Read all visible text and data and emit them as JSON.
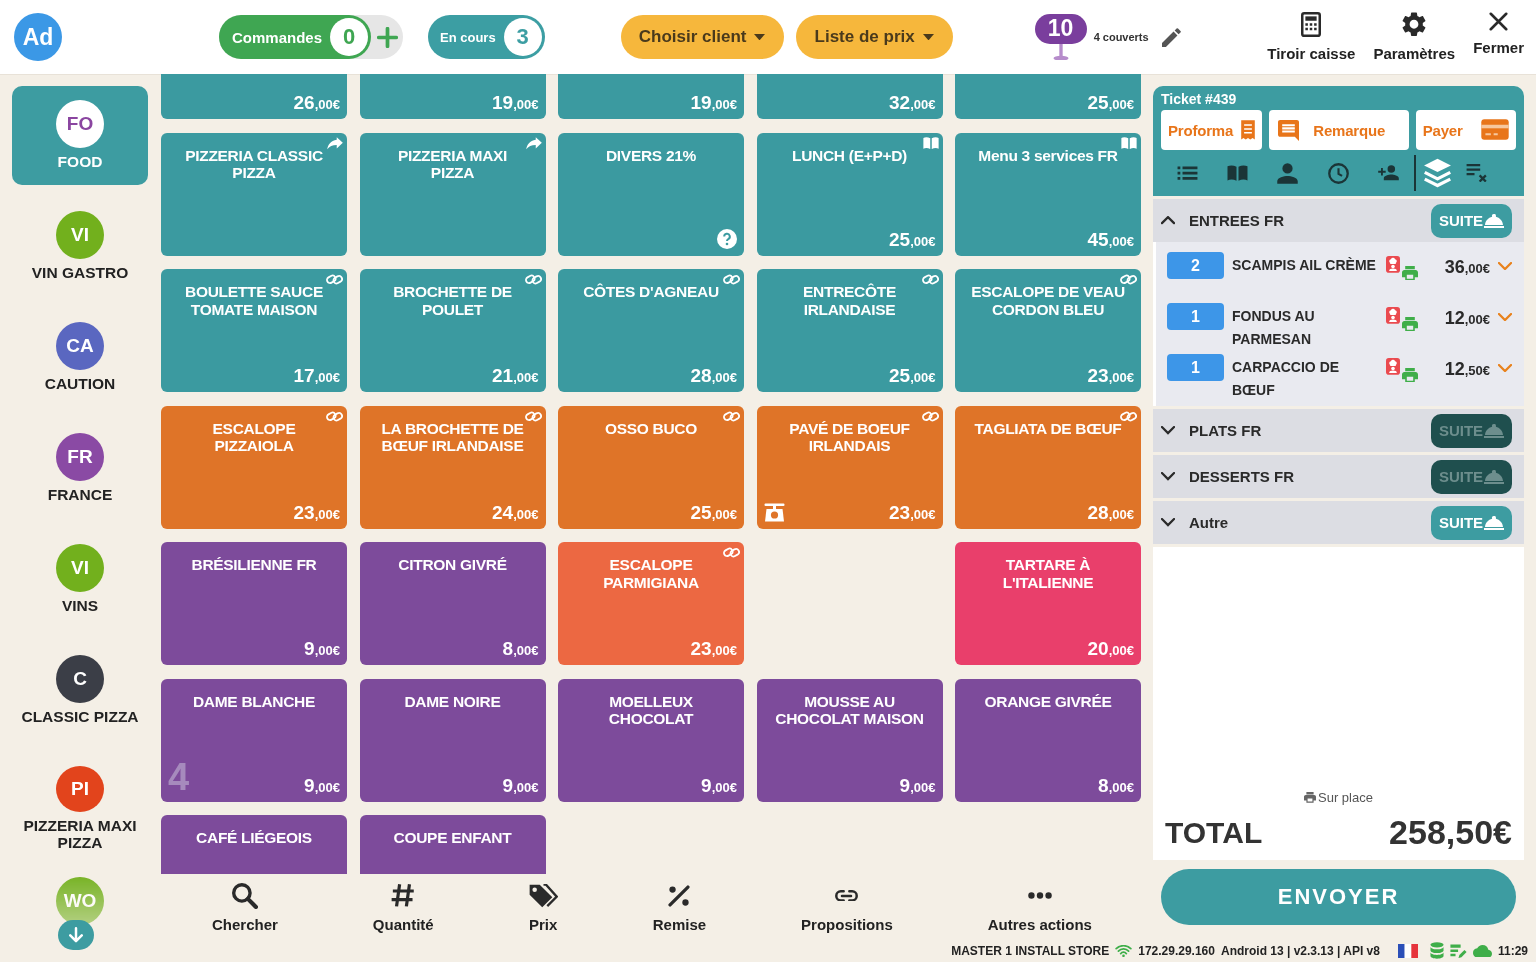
{
  "topbar": {
    "avatar": "Ad",
    "orders": {
      "label": "Commandes",
      "count": "0"
    },
    "in_progress": {
      "label": "En cours",
      "count": "3"
    },
    "client_button": "Choisir client",
    "price_list_button": "Liste de prix",
    "table": {
      "number": "10",
      "covers": "4 couverts"
    },
    "actions": [
      {
        "kind": "calculator",
        "label": "Tiroir caisse"
      },
      {
        "kind": "gear",
        "label": "Paramètres"
      },
      {
        "kind": "close",
        "label": "Fermer"
      }
    ]
  },
  "categories": [
    {
      "initials": "FO",
      "label": "FOOD",
      "color": "#8a45a0",
      "selected": true
    },
    {
      "initials": "VI",
      "label": "VIN GASTRO",
      "color": "#72b01d",
      "selected": false
    },
    {
      "initials": "CA",
      "label": "CAUTION",
      "color": "#5a67c0",
      "selected": false
    },
    {
      "initials": "FR",
      "label": "FRANCE",
      "color": "#8a4aa4",
      "selected": false
    },
    {
      "initials": "VI",
      "label": "VINS",
      "color": "#72b01d",
      "selected": false
    },
    {
      "initials": "C",
      "label": "CLASSIC PIZZA",
      "color": "#3b3e47",
      "selected": false
    },
    {
      "initials": "PI",
      "label": "PIZZERIA MAXI PIZZA",
      "color": "#e2441c",
      "selected": false
    },
    {
      "initials": "WO",
      "color": "#72b01d",
      "selected": false
    }
  ],
  "tiles": [
    {
      "price": "26,00€",
      "color": "#3b9aa0",
      "kind": "plain",
      "open_price": false,
      "weighed": false
    },
    {
      "price": "19,00€",
      "color": "#3b9aa0",
      "kind": "plain",
      "open_price": false,
      "weighed": false
    },
    {
      "price": "19,00€",
      "color": "#3b9aa0",
      "kind": "plain",
      "open_price": false,
      "weighed": false
    },
    {
      "price": "32,00€",
      "color": "#3b9aa0",
      "kind": "plain",
      "open_price": false,
      "weighed": false
    },
    {
      "price": "25,00€",
      "color": "#3b9aa0",
      "kind": "plain",
      "open_price": false,
      "weighed": false
    },
    {
      "name": "PIZZERIA CLASSIC PIZZA",
      "color": "#3b9aa0",
      "kind": "redirect",
      "open_price": false,
      "weighed": false
    },
    {
      "name": "PIZZERIA MAXI PIZZA",
      "color": "#3b9aa0",
      "kind": "redirect",
      "open_price": false,
      "weighed": false
    },
    {
      "name": "DIVERS 21%",
      "color": "#3b9aa0",
      "kind": "plain",
      "open_price": true,
      "weighed": false
    },
    {
      "name": "LUNCH (E+P+D)",
      "price": "25,00€",
      "color": "#3b9aa0",
      "kind": "menu",
      "open_price": false,
      "weighed": false
    },
    {
      "name": "Menu 3 services FR",
      "price": "45,00€",
      "color": "#3b9aa0",
      "kind": "menu",
      "open_price": false,
      "weighed": false
    },
    {
      "name": "BOULETTE SAUCE TOMATE MAISON",
      "price": "17,00€",
      "color": "#3b9aa0",
      "kind": "link",
      "open_price": false,
      "weighed": false
    },
    {
      "name": "BROCHETTE DE POULET",
      "price": "21,00€",
      "color": "#3b9aa0",
      "kind": "link",
      "open_price": false,
      "weighed": false
    },
    {
      "name": "CÔTES D'AGNEAU",
      "price": "28,00€",
      "color": "#3b9aa0",
      "kind": "link",
      "open_price": false,
      "weighed": false
    },
    {
      "name": "ENTRECÔTE IRLANDAISE",
      "price": "25,00€",
      "color": "#3b9aa0",
      "kind": "link",
      "open_price": false,
      "weighed": false
    },
    {
      "name": "ESCALOPE DE VEAU CORDON BLEU",
      "price": "23,00€",
      "color": "#3b9aa0",
      "kind": "link",
      "open_price": false,
      "weighed": false
    },
    {
      "name": "ESCALOPE PIZZAIOLA",
      "price": "23,00€",
      "color": "#df7428",
      "kind": "link",
      "open_price": false,
      "weighed": false
    },
    {
      "name": "LA BROCHETTE DE BŒUF IRLANDAISE",
      "price": "24,00€",
      "color": "#df7428",
      "kind": "link",
      "open_price": false,
      "weighed": false
    },
    {
      "name": "OSSO BUCO",
      "price": "25,00€",
      "color": "#df7428",
      "kind": "link",
      "open_price": false,
      "weighed": false
    },
    {
      "name": "PAVÉ DE BOEUF IRLANDAIS",
      "price": "23,00€",
      "color": "#df7428",
      "kind": "link",
      "open_price": false,
      "weighed": true
    },
    {
      "name": "TAGLIATA DE BŒUF",
      "price": "28,00€",
      "color": "#df7428",
      "kind": "link",
      "open_price": false,
      "weighed": false
    },
    {
      "name": "BRÉSILIENNE FR",
      "price": "9,00€",
      "color": "#7d4b9b",
      "kind": "plain",
      "open_price": false,
      "weighed": false
    },
    {
      "name": "CITRON GIVRÉ",
      "price": "8,00€",
      "color": "#7d4b9b",
      "kind": "plain",
      "open_price": false,
      "weighed": false
    },
    {
      "name": "ESCALOPE PARMIGIANA",
      "price": "23,00€",
      "color": "#ec6842",
      "kind": "link",
      "open_price": false,
      "weighed": false
    },
    {
      "kind": "empty"
    },
    {
      "name": "TARTARE À L'ITALIENNE",
      "price": "20,00€",
      "color": "#e93f6b",
      "kind": "plain",
      "open_price": false,
      "weighed": false
    },
    {
      "name": "DAME BLANCHE",
      "price": "9,00€",
      "stock": "4",
      "color": "#7d4b9b",
      "kind": "plain",
      "open_price": false,
      "weighed": false
    },
    {
      "name": "DAME NOIRE",
      "price": "9,00€",
      "color": "#7d4b9b",
      "kind": "plain",
      "open_price": false,
      "weighed": false
    },
    {
      "name": "MOELLEUX CHOCOLAT",
      "price": "9,00€",
      "color": "#7d4b9b",
      "kind": "plain",
      "open_price": false,
      "weighed": false
    },
    {
      "name": "MOUSSE AU CHOCOLAT MAISON",
      "price": "9,00€",
      "color": "#7d4b9b",
      "kind": "plain",
      "open_price": false,
      "weighed": false
    },
    {
      "name": "ORANGE GIVRÉE",
      "price": "8,00€",
      "color": "#7d4b9b",
      "kind": "plain",
      "open_price": false,
      "weighed": false
    },
    {
      "name": "CAFÉ LIÉGEOIS",
      "color": "#7d4b9b",
      "kind": "plain",
      "open_price": false,
      "weighed": false
    },
    {
      "name": "COUPE ENFANT",
      "color": "#7d4b9b",
      "kind": "plain",
      "open_price": false,
      "weighed": false
    }
  ],
  "toolbar": [
    {
      "kind": "search",
      "label": "Chercher"
    },
    {
      "kind": "hash",
      "label": "Quantité"
    },
    {
      "kind": "tags",
      "label": "Prix"
    },
    {
      "kind": "percent",
      "label": "Remise"
    },
    {
      "kind": "link",
      "label": "Propositions"
    },
    {
      "kind": "dots",
      "label": "Autres actions"
    }
  ],
  "ticket": {
    "title": "Ticket #439",
    "buttons": [
      {
        "kind": "receipt",
        "label": "Proforma"
      },
      {
        "kind": "note",
        "label": "Remarque"
      },
      {
        "kind": "card",
        "label": "Payer"
      }
    ],
    "tools": [
      {
        "kind": "list",
        "selected": false
      },
      {
        "kind": "book",
        "selected": false
      },
      {
        "kind": "person",
        "selected": false
      },
      {
        "kind": "clock",
        "selected": false
      },
      {
        "kind": "add-person",
        "selected": false
      }
    ],
    "view_tools": [
      {
        "kind": "layers",
        "selected": true
      },
      {
        "kind": "clear",
        "selected": false
      }
    ],
    "sections": [
      {
        "name": "ENTREES FR",
        "expanded": true,
        "suite": "SUITE",
        "suite_disabled": false,
        "items": [
          {
            "qty": "2",
            "name": "SCAMPIS AIL CRÈME",
            "price": "36,00€"
          },
          {
            "qty": "1",
            "name": "FONDUS AU PARMESAN",
            "price": "12,00€"
          },
          {
            "qty": "1",
            "name": "CARPACCIO DE BŒUF",
            "price": "12,50€"
          }
        ]
      },
      {
        "name": "PLATS FR",
        "expanded": false,
        "suite": "SUITE",
        "suite_disabled": true
      },
      {
        "name": "DESSERTS FR",
        "expanded": false,
        "suite": "SUITE",
        "suite_disabled": true
      },
      {
        "name": "Autre",
        "expanded": false,
        "suite": "SUITE",
        "suite_disabled": false
      }
    ],
    "service": "Sur place",
    "total_label": "TOTAL",
    "total": "258,50€",
    "send_button": "ENVOYER"
  },
  "status_bar": {
    "device": "MASTER 1 INSTALL STORE",
    "ip": "172.29.29.160",
    "system": "Android 13 | v2.3.13 | API v8",
    "time": "11:29"
  }
}
